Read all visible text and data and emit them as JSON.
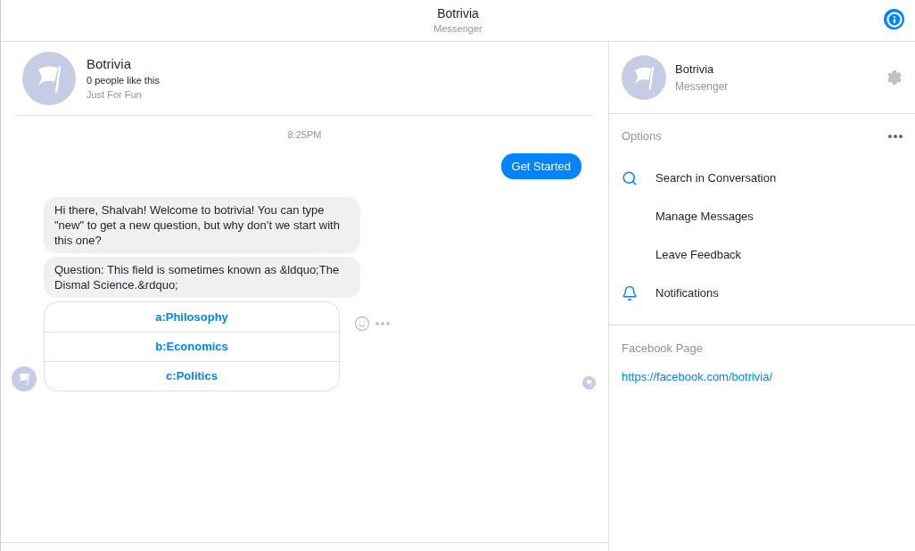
{
  "header": {
    "title": "Botrivia",
    "subtitle": "Messenger"
  },
  "page_card": {
    "name": "Botrivia",
    "likes": "0 people like this",
    "category": "Just For Fun"
  },
  "timestamp": "8:25PM",
  "messages": [
    {
      "kind": "outgoing",
      "text": "Get Started"
    },
    {
      "kind": "incoming",
      "text": "Hi there, Shalvah! Welcome to botrivia! You can type \"new\" to get a new question, but why don’t we start with this one?"
    },
    {
      "kind": "incoming",
      "text": "Question: This field is sometimes known as &ldquo;The Dismal Science.&rdquo;"
    }
  ],
  "quick_replies": [
    "a:Philosophy",
    "b:Economics",
    "c:Politics"
  ],
  "sidebar": {
    "name": "Botrivia",
    "subtitle": "Messenger",
    "options_heading": "Options",
    "options": [
      {
        "kind": "search",
        "label": "Search in Conversation"
      },
      {
        "kind": "none",
        "label": "Manage Messages"
      },
      {
        "kind": "none",
        "label": "Leave Feedback"
      },
      {
        "kind": "bell",
        "label": "Notifications"
      }
    ],
    "page_heading": "Facebook Page",
    "page_link": "https://facebook.com/botrivia/"
  }
}
